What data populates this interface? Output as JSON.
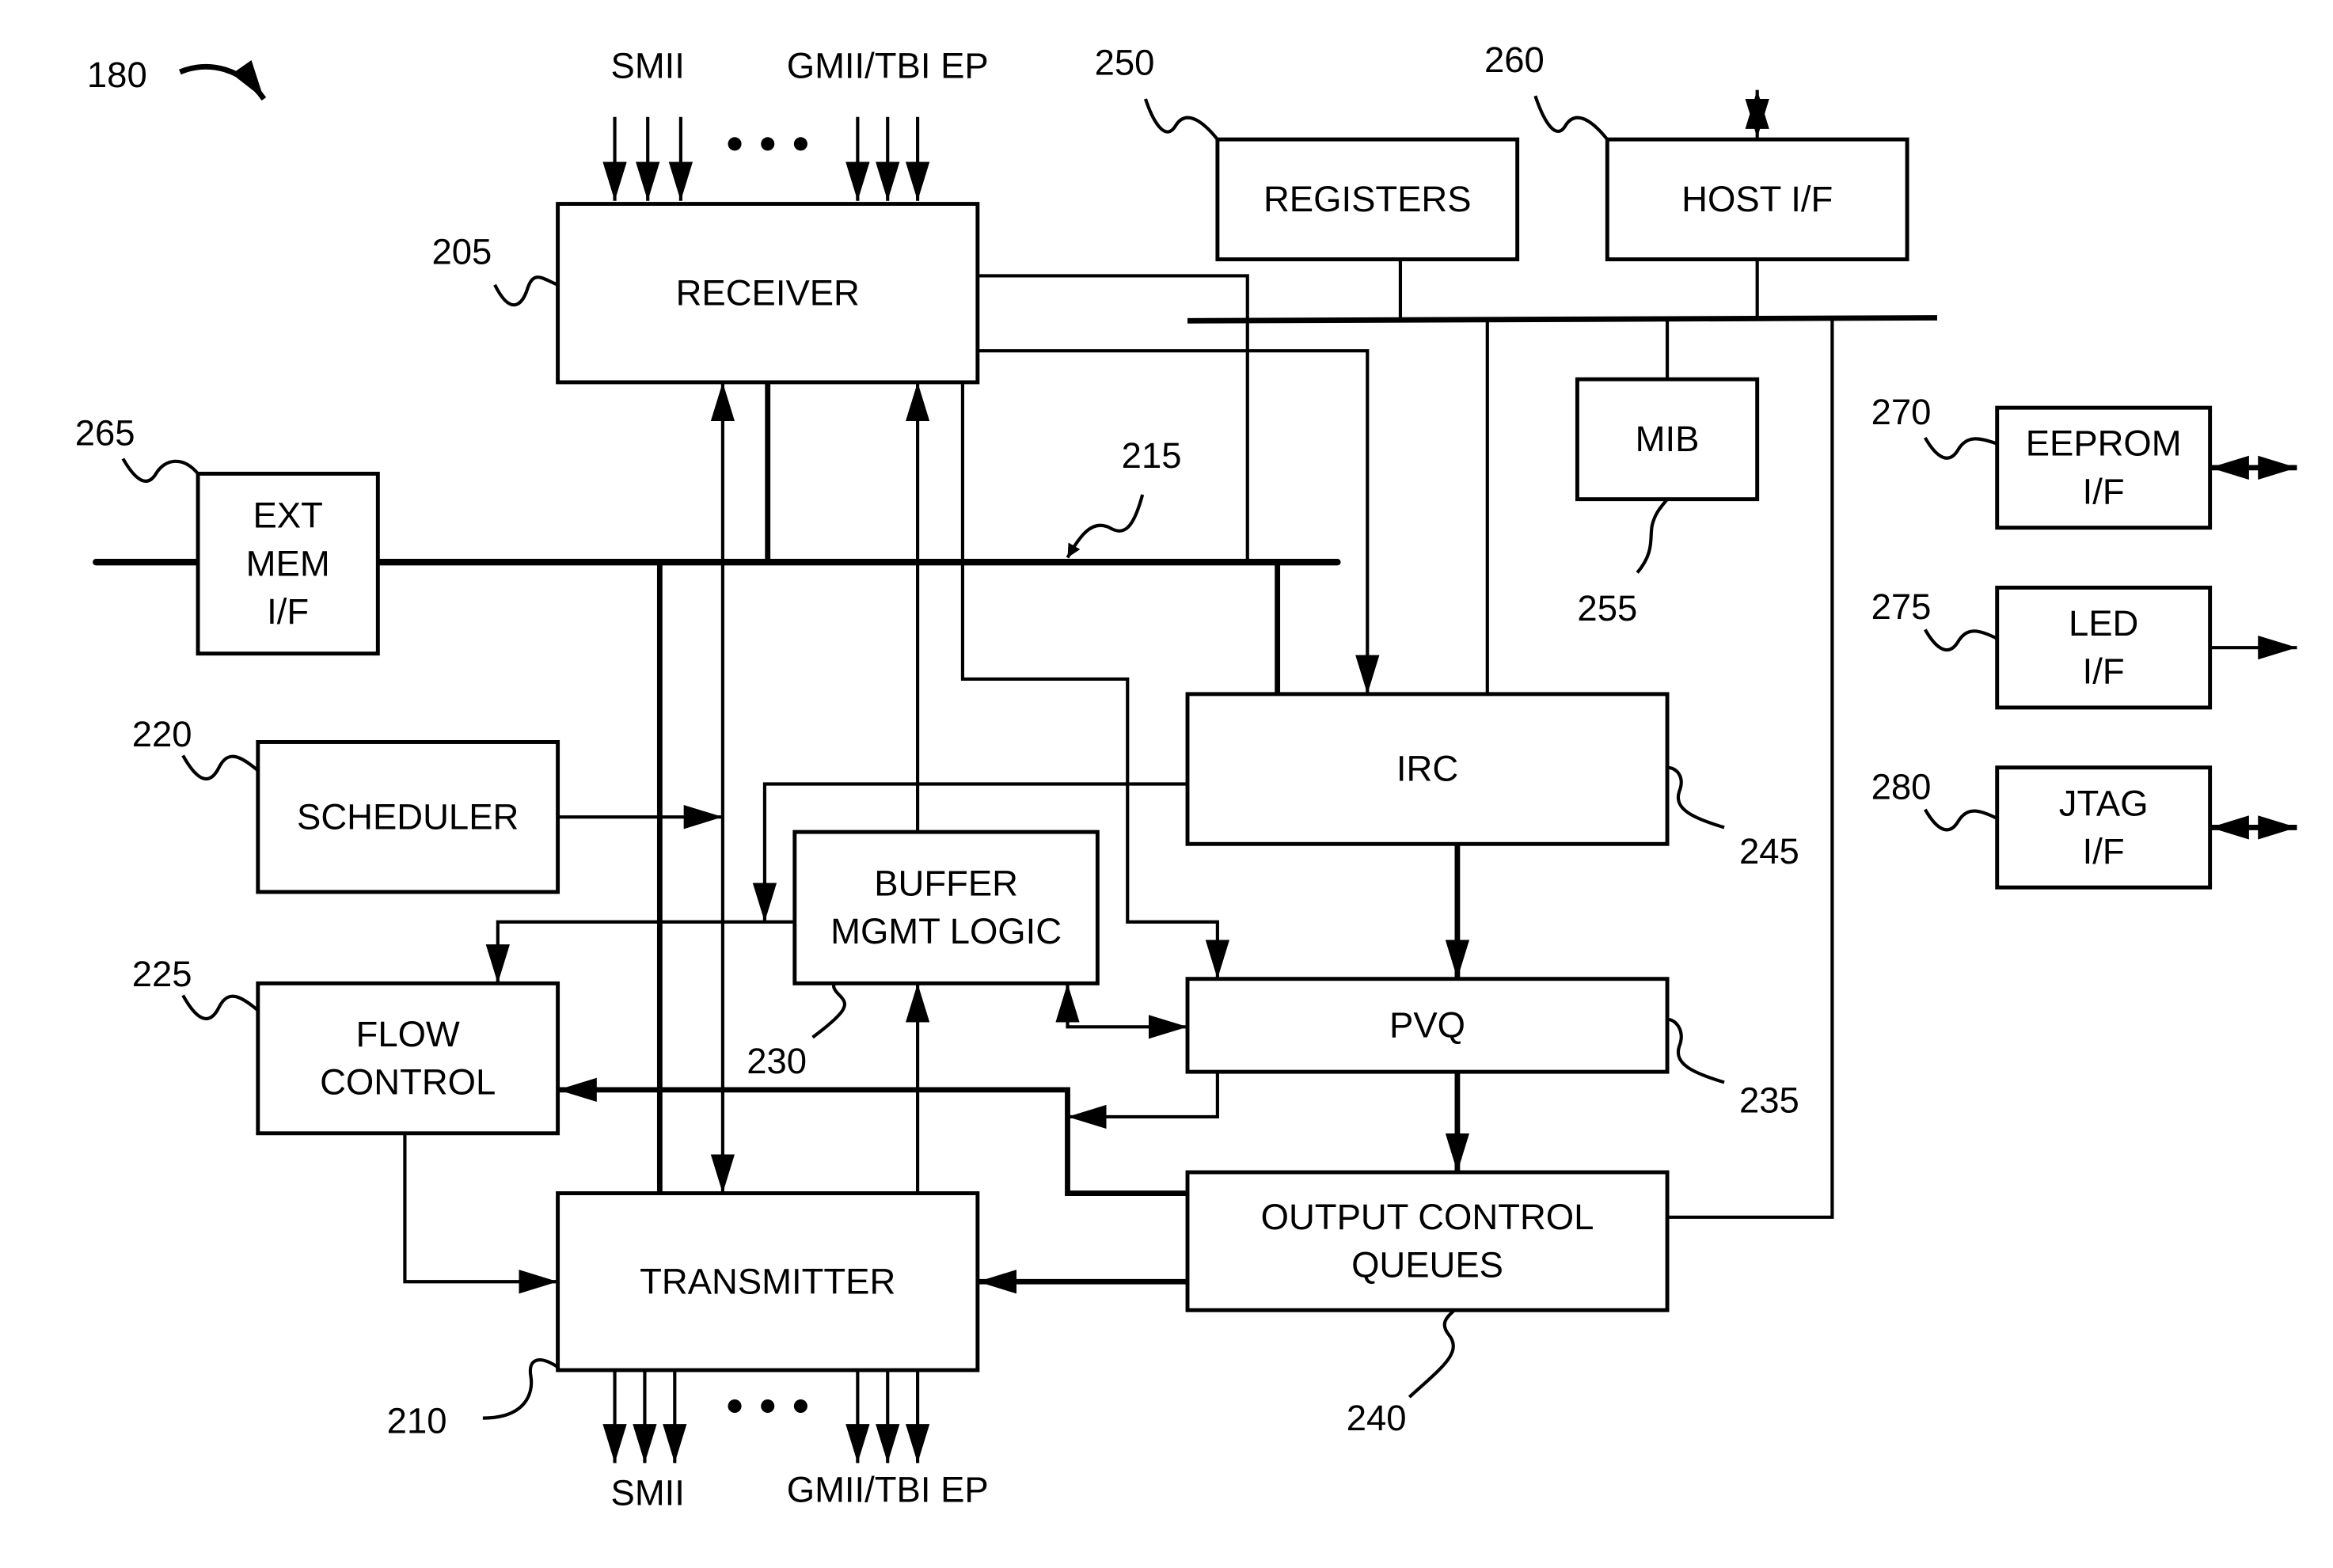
{
  "figure": {
    "ref_label": "180",
    "input_labels": {
      "smii": "SMII",
      "gmii": "GMII/TBI EP"
    },
    "output_labels": {
      "smii": "SMII",
      "gmii": "GMII/TBI EP"
    }
  },
  "blocks": {
    "receiver": {
      "ref": "205",
      "lines": [
        "RECEIVER"
      ]
    },
    "transmitter": {
      "ref": "210",
      "lines": [
        "TRANSMITTER"
      ]
    },
    "bus": {
      "ref": "215"
    },
    "scheduler": {
      "ref": "220",
      "lines": [
        "SCHEDULER"
      ]
    },
    "flow_control": {
      "ref": "225",
      "lines": [
        "FLOW",
        "CONTROL"
      ]
    },
    "buffer_mgmt": {
      "ref": "230",
      "lines": [
        "BUFFER",
        "MGMT LOGIC"
      ]
    },
    "pvq": {
      "ref": "235",
      "lines": [
        "PVQ"
      ]
    },
    "output_queues": {
      "ref": "240",
      "lines": [
        "OUTPUT CONTROL",
        "QUEUES"
      ]
    },
    "irc": {
      "ref": "245",
      "lines": [
        "IRC"
      ]
    },
    "registers": {
      "ref": "250",
      "lines": [
        "REGISTERS"
      ]
    },
    "mib": {
      "ref": "255",
      "lines": [
        "MIB"
      ]
    },
    "host_if": {
      "ref": "260",
      "lines": [
        "HOST I/F"
      ]
    },
    "ext_mem_if": {
      "ref": "265",
      "lines": [
        "EXT",
        "MEM",
        "I/F"
      ]
    },
    "eeprom_if": {
      "ref": "270",
      "lines": [
        "EEPROM",
        "I/F"
      ]
    },
    "led_if": {
      "ref": "275",
      "lines": [
        "LED",
        "I/F"
      ]
    },
    "jtag_if": {
      "ref": "280",
      "lines": [
        "JTAG",
        "I/F"
      ]
    }
  }
}
